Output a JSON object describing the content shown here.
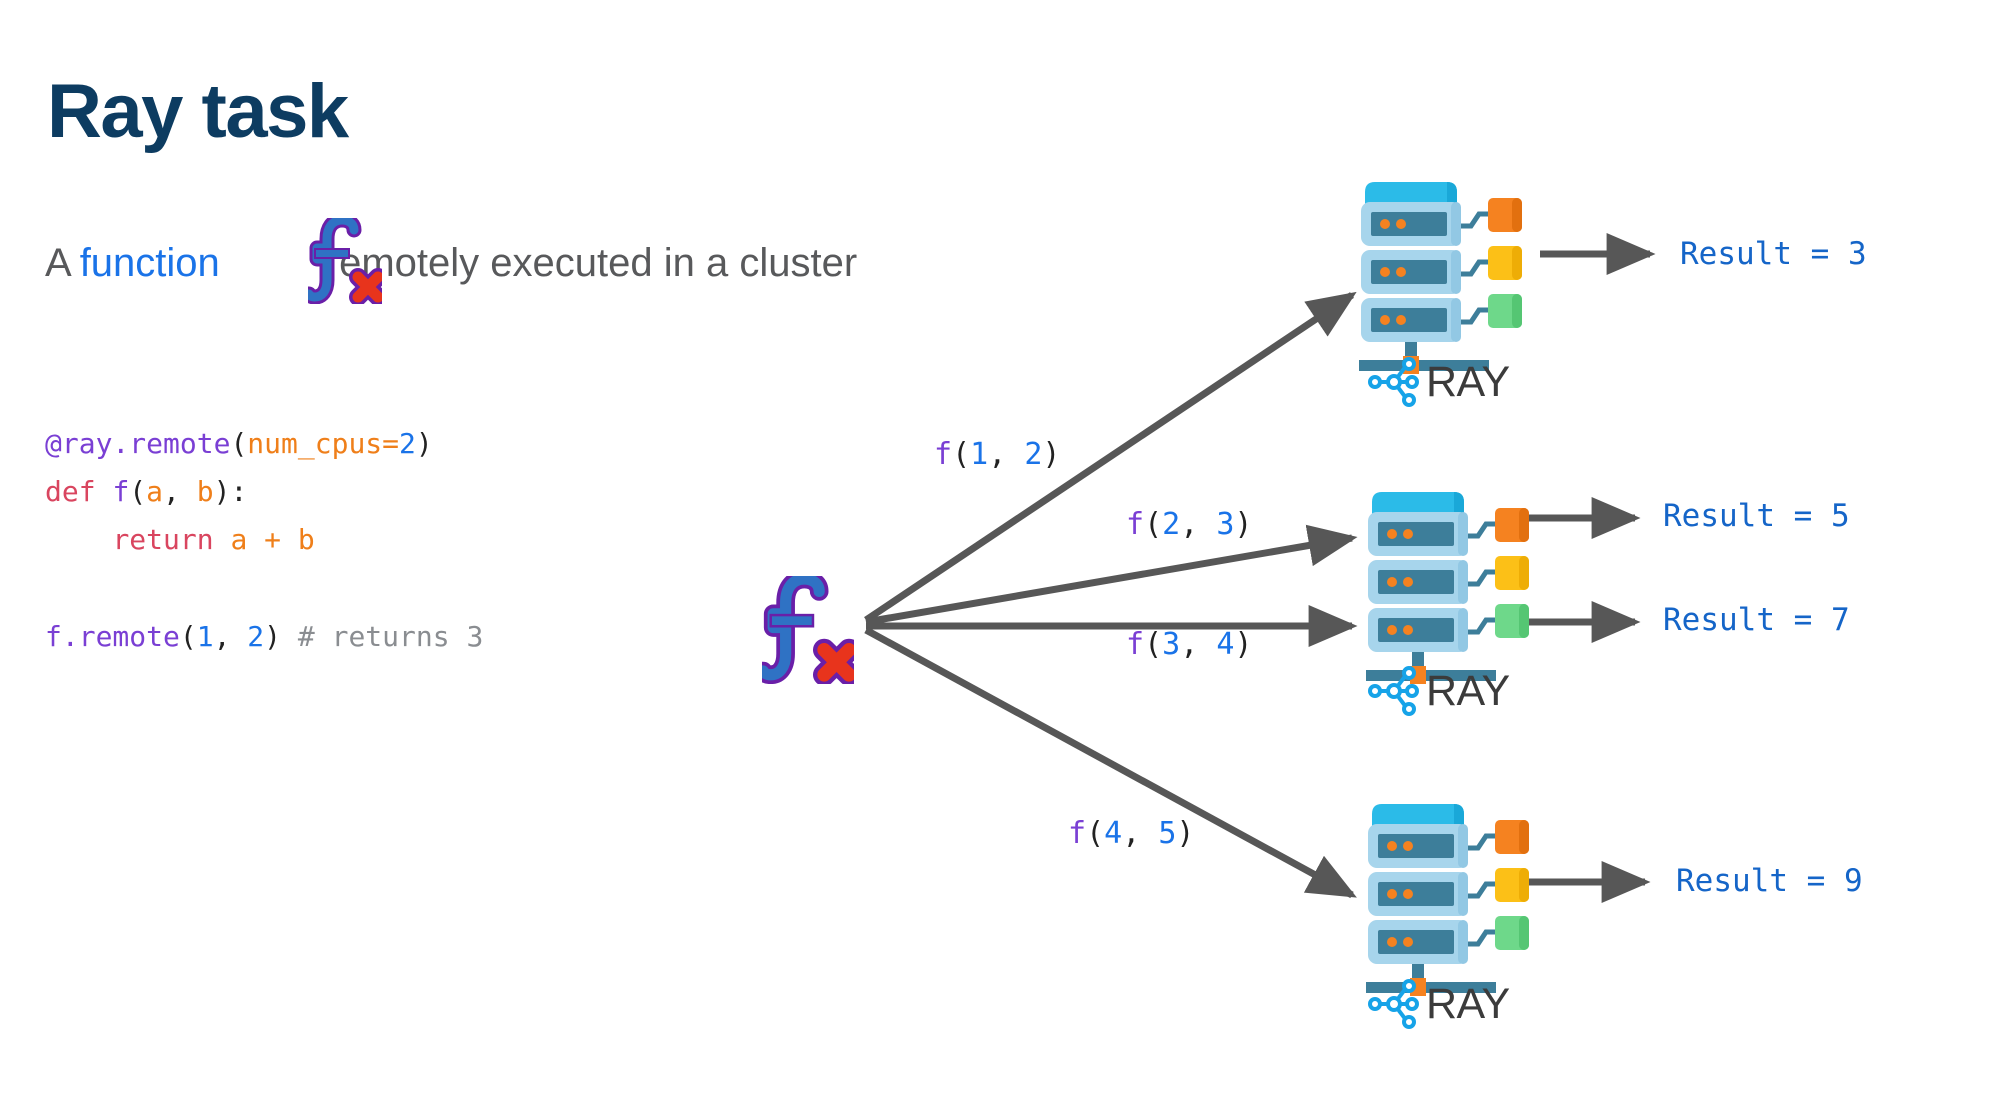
{
  "slide": {
    "title": "Ray task",
    "subtitle": {
      "lead": "A",
      "highlight": "function",
      "tail": "remotely executed in a cluster"
    }
  },
  "icons": {
    "fx_inline": "fx-function-icon",
    "fx_center": "fx-function-icon",
    "ray_logo": "ray-logo-icon",
    "server_rack": "server-rack-icon"
  },
  "code": {
    "lines": [
      {
        "tokens": [
          {
            "t": "@ray.remote",
            "c": "tok-decorator"
          },
          {
            "t": "(",
            "c": "tok-punc"
          },
          {
            "t": "num_cpus",
            "c": "tok-param"
          },
          {
            "t": "=",
            "c": "tok-op"
          },
          {
            "t": "2",
            "c": "tok-num"
          },
          {
            "t": ")",
            "c": "tok-punc"
          }
        ]
      },
      {
        "tokens": [
          {
            "t": "def ",
            "c": "tok-kw"
          },
          {
            "t": "f",
            "c": "tok-fn"
          },
          {
            "t": "(",
            "c": "tok-punc"
          },
          {
            "t": "a",
            "c": "tok-param"
          },
          {
            "t": ", ",
            "c": "tok-punc"
          },
          {
            "t": "b",
            "c": "tok-param"
          },
          {
            "t": "):",
            "c": "tok-punc"
          }
        ]
      },
      {
        "tokens": [
          {
            "t": "    ",
            "c": "tok-plain"
          },
          {
            "t": "return ",
            "c": "tok-kw"
          },
          {
            "t": "a",
            "c": "tok-param"
          },
          {
            "t": " + ",
            "c": "tok-op"
          },
          {
            "t": "b",
            "c": "tok-param"
          }
        ]
      },
      {
        "tokens": []
      },
      {
        "tokens": [
          {
            "t": "f.remote",
            "c": "tok-fn"
          },
          {
            "t": "(",
            "c": "tok-punc"
          },
          {
            "t": "1",
            "c": "tok-num"
          },
          {
            "t": ", ",
            "c": "tok-punc"
          },
          {
            "t": "2",
            "c": "tok-num"
          },
          {
            "t": ")",
            "c": "tok-punc"
          },
          {
            "t": " # returns 3",
            "c": "tok-comment"
          }
        ]
      }
    ]
  },
  "diagram": {
    "source": "fx",
    "arrow_labels": [
      {
        "id": "f12",
        "fn": "f",
        "open": "(",
        "a": "1",
        "sep": ", ",
        "b": "2",
        "close": ")"
      },
      {
        "id": "f23",
        "fn": "f",
        "open": "(",
        "a": "2",
        "sep": ", ",
        "b": "3",
        "close": ")"
      },
      {
        "id": "f34",
        "fn": "f",
        "open": "(",
        "a": "3",
        "sep": ", ",
        "b": "4",
        "close": ")"
      },
      {
        "id": "f45",
        "fn": "f",
        "open": "(",
        "a": "4",
        "sep": ", ",
        "b": "5",
        "close": ")"
      }
    ],
    "results": [
      {
        "id": "r1",
        "text": "Result = 3"
      },
      {
        "id": "r2",
        "text": "Result = 5"
      },
      {
        "id": "r3",
        "text": "Result = 7"
      },
      {
        "id": "r4",
        "text": "Result = 9"
      }
    ],
    "clusters": [
      {
        "id": "cluster-1",
        "ray_label": "RAY"
      },
      {
        "id": "cluster-2",
        "ray_label": "RAY"
      },
      {
        "id": "cluster-3",
        "ray_label": "RAY"
      }
    ]
  },
  "colors": {
    "title": "#0d3c61",
    "subtitle_text": "#58595b",
    "accent_blue": "#1a73e8",
    "result_blue": "#1565c8",
    "arrow_gray": "#575757",
    "rack_light": "#a7d5ec",
    "rack_mid": "#3d7e9a",
    "rack_top": "#2bbbe8",
    "box_orange": "#f58220",
    "box_yellow": "#fcc017",
    "box_green": "#6ed88a",
    "ray_blue": "#16a3e8",
    "fx_blue": "#2f72c4",
    "fx_purple": "#6a1fa8",
    "fx_red": "#e8341c"
  }
}
